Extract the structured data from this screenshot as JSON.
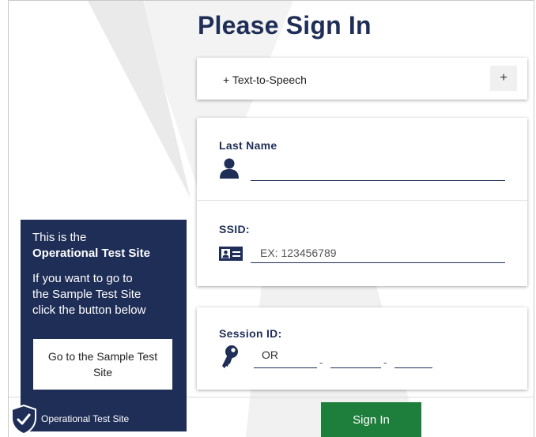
{
  "page": {
    "title": "Please Sign In"
  },
  "tts": {
    "label": "+ Text-to-Speech",
    "expand_label": "+"
  },
  "form": {
    "last_name": {
      "label": "Last Name",
      "value": ""
    },
    "ssid": {
      "label": "SSID:",
      "placeholder": "EX: 123456789",
      "value": ""
    },
    "session": {
      "label": "Session ID:",
      "prefix": "OR",
      "separator": "-"
    }
  },
  "info_panel": {
    "line1": "This is the",
    "line2": "Operational Test Site",
    "line3": "If you want to go to",
    "line4": "the Sample Test Site",
    "line5": "click the button below",
    "sample_button": "Go to the Sample Test Site",
    "site_label": "Operational Test Site"
  },
  "actions": {
    "sign_in": "Sign In"
  },
  "colors": {
    "navy": "#1f2e57",
    "green": "#1e7f3c"
  },
  "icons": [
    "person-icon",
    "id-card-icon",
    "key-icon",
    "shield-check-icon"
  ]
}
